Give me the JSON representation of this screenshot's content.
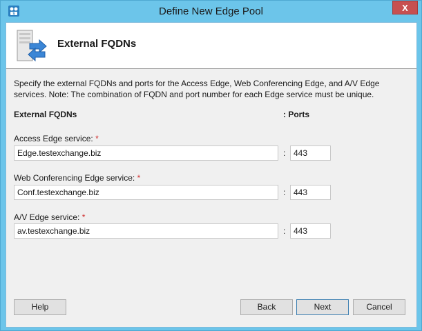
{
  "window": {
    "title": "Define New Edge Pool",
    "close_label": "X"
  },
  "header": {
    "title": "External FQDNs"
  },
  "description": "Specify the external FQDNs and ports for the Access Edge, Web Conferencing Edge, and A/V Edge services. Note: The combination of FQDN and port number for each Edge service must be unique.",
  "columns": {
    "fqdn": "External FQDNs",
    "ports": ": Ports"
  },
  "fields": [
    {
      "label": "Access Edge service:",
      "required_mark": "*",
      "fqdn": "Edge.testexchange.biz",
      "port": "443"
    },
    {
      "label": "Web Conferencing Edge service:",
      "required_mark": "*",
      "fqdn": "Conf.testexchange.biz",
      "port": "443"
    },
    {
      "label": "A/V Edge service:",
      "required_mark": "*",
      "fqdn": "av.testexchange.biz",
      "port": "443"
    }
  ],
  "colon": ":",
  "buttons": {
    "help": "Help",
    "back": "Back",
    "next": "Next",
    "cancel": "Cancel"
  },
  "colors": {
    "titlebar": "#6cc5ea",
    "close": "#c75050",
    "required": "#d03030"
  }
}
